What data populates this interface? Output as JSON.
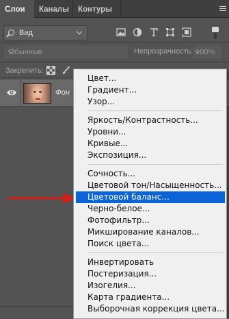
{
  "tabs": [
    {
      "label": "Слои",
      "active": true
    },
    {
      "label": "Каналы",
      "active": false
    },
    {
      "label": "Контуры",
      "active": false
    }
  ],
  "filter": {
    "kind_label": "Вид"
  },
  "blend": {
    "mode": "Обычные",
    "opacity_label": "Непрозрачность:",
    "opacity_value": "100%"
  },
  "lock": {
    "label": "Закрепить:"
  },
  "layer": {
    "name": "Фон",
    "visible": true
  },
  "highlight_color": "#0a64d8",
  "arrow_color": "#d0211c",
  "menu": {
    "groups": [
      [
        "Цвет...",
        "Градиент...",
        "Узор..."
      ],
      [
        "Яркость/Контрастность...",
        "Уровни...",
        "Кривые...",
        "Экспозиция..."
      ],
      [
        "Сочность...",
        "Цветовой тон/Насыщенность...",
        "Цветовой баланс...",
        "Черно-белое...",
        "Фотофильтр...",
        "Микширование каналов...",
        "Поиск цвета..."
      ],
      [
        "Инвертировать",
        "Постеризация...",
        "Изогелия...",
        "Карта градиента...",
        "Выборочная коррекция цвета..."
      ]
    ],
    "highlighted": "Цветовой баланс..."
  }
}
